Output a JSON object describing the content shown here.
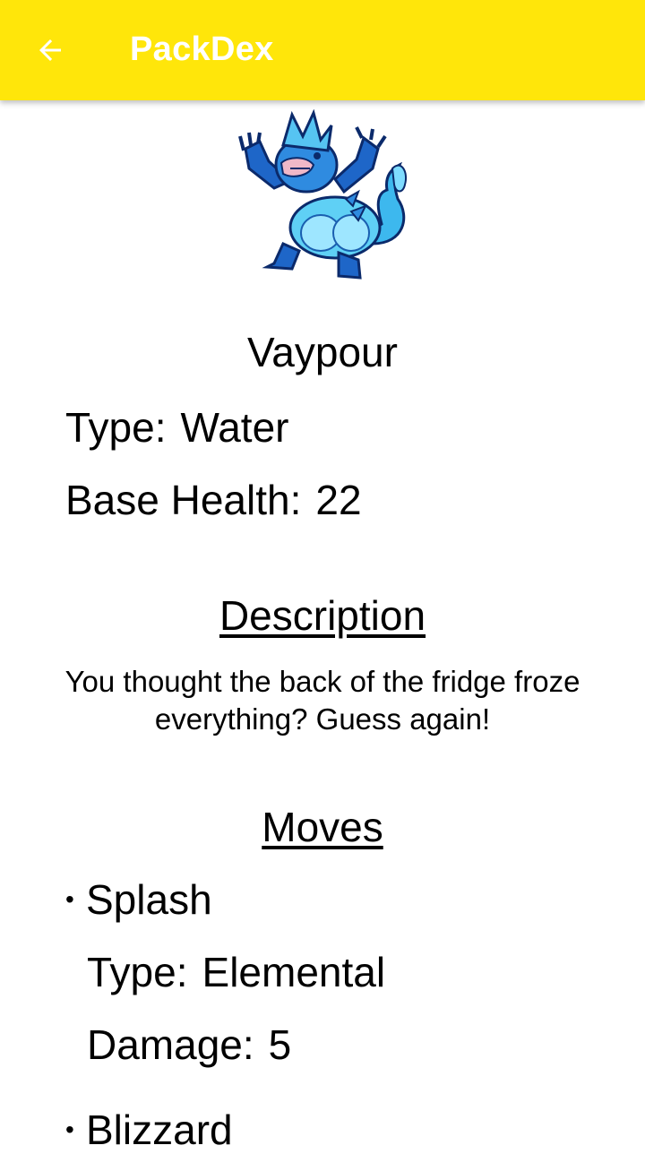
{
  "appbar": {
    "title": "PackDex",
    "back_icon": "arrow-back-icon",
    "color": "#ffe60a"
  },
  "creature": {
    "sprite_icon": "creature-sprite-icon",
    "name": "Vaypour",
    "type_label": "Type:",
    "type_value": "Water",
    "health_label": "Base Health:",
    "health_value": "22"
  },
  "description": {
    "heading": "Description",
    "text": "You thought the back of the fridge froze everything? Guess again!"
  },
  "moves": {
    "heading": "Moves",
    "items": [
      {
        "bullet": "•",
        "name": "Splash",
        "type_label": "Type:",
        "type_value": "Elemental",
        "damage_label": "Damage:",
        "damage_value": "5"
      },
      {
        "bullet": "•",
        "name": "Blizzard"
      }
    ]
  }
}
